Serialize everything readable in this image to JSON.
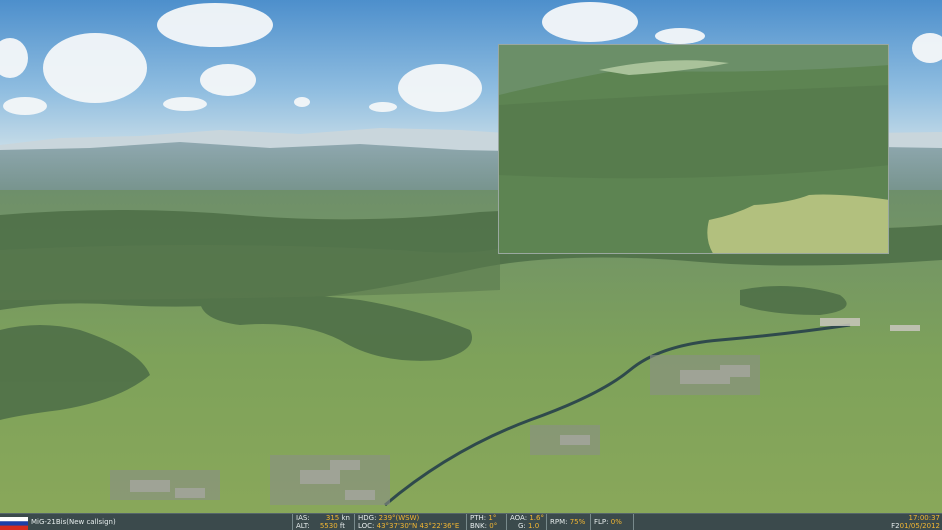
{
  "scene": {
    "description_free": true
  },
  "hud": {
    "aircraft": "MiG-21Bis(New callsign)",
    "ias_label": "IAS:",
    "ias_value": "315",
    "ias_unit": "kn",
    "alt_label": "ALT:",
    "alt_value": "5530",
    "alt_unit": "ft",
    "hdg_label": "HDG:",
    "hdg_value": "239°(WSW)",
    "loc_label": "LOC:",
    "loc_value": "43°37'30\"N 43°22'36\"E",
    "pth_label": "PTH:",
    "pth_value": "1°",
    "bnk_label": "BNK:",
    "bnk_value": "0°",
    "aoa_label": "AOA:",
    "aoa_value": "1.6°",
    "g_label": "G:",
    "g_value": "1.0",
    "rpm_label": "RPM:",
    "rpm_value": "75%",
    "flp_label": "FLP:",
    "flp_value": "0%",
    "time": "17:00:37",
    "f2_label": "F2",
    "date": "01/05/2012",
    "flag_colors": [
      "#ffffff",
      "#1c3fa8",
      "#d52b1e"
    ]
  }
}
